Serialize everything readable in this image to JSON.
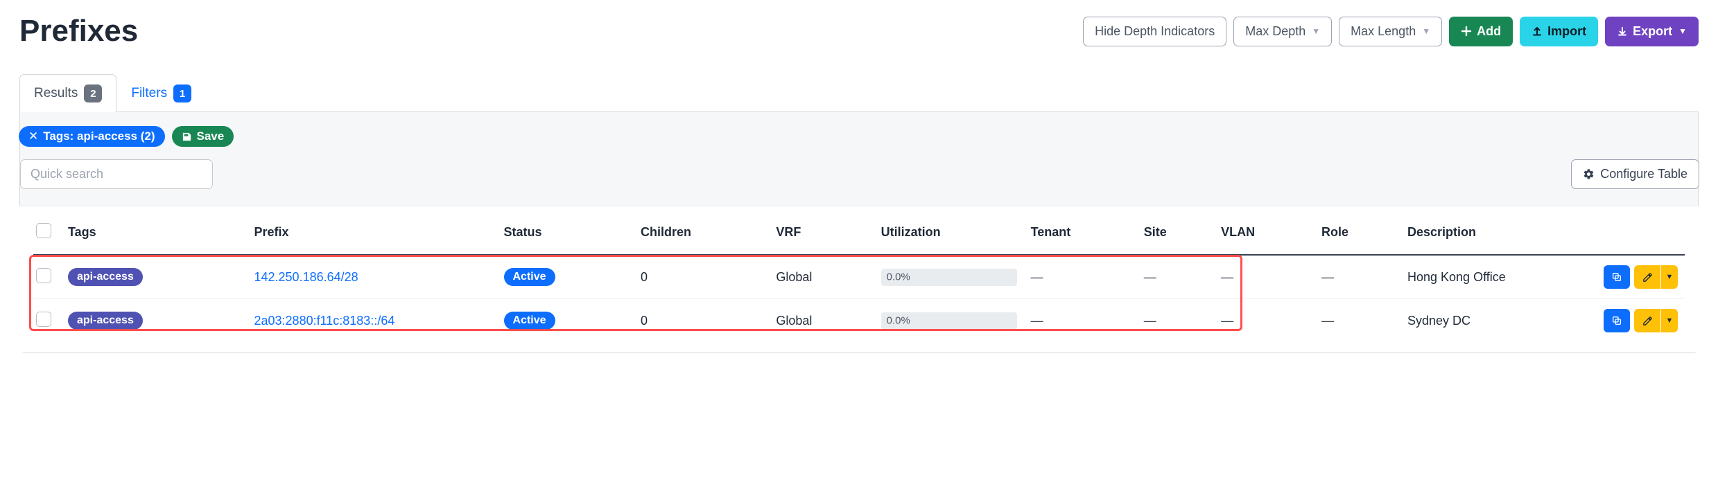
{
  "page": {
    "title": "Prefixes"
  },
  "toolbar": {
    "hide_depth": "Hide Depth Indicators",
    "max_depth": "Max Depth",
    "max_length": "Max Length",
    "add": "Add",
    "import": "Import",
    "export": "Export"
  },
  "tabs": {
    "results": {
      "label": "Results",
      "count": "2"
    },
    "filters": {
      "label": "Filters",
      "count": "1"
    }
  },
  "filter_pills": {
    "tag_filter": "Tags: api-access (2)",
    "save": "Save"
  },
  "search": {
    "placeholder": "Quick search"
  },
  "configure": {
    "label": "Configure Table"
  },
  "table": {
    "headers": {
      "tags": "Tags",
      "prefix": "Prefix",
      "status": "Status",
      "children": "Children",
      "vrf": "VRF",
      "utilization": "Utilization",
      "tenant": "Tenant",
      "site": "Site",
      "vlan": "VLAN",
      "role": "Role",
      "description": "Description"
    },
    "rows": [
      {
        "tag": "api-access",
        "prefix": "142.250.186.64/28",
        "status": "Active",
        "children": "0",
        "vrf": "Global",
        "utilization": "0.0%",
        "tenant": "—",
        "site": "—",
        "vlan": "—",
        "role": "—",
        "description": "Hong Kong Office"
      },
      {
        "tag": "api-access",
        "prefix": "2a03:2880:f11c:8183::/64",
        "status": "Active",
        "children": "0",
        "vrf": "Global",
        "utilization": "0.0%",
        "tenant": "—",
        "site": "—",
        "vlan": "—",
        "role": "—",
        "description": "Sydney DC"
      }
    ]
  }
}
